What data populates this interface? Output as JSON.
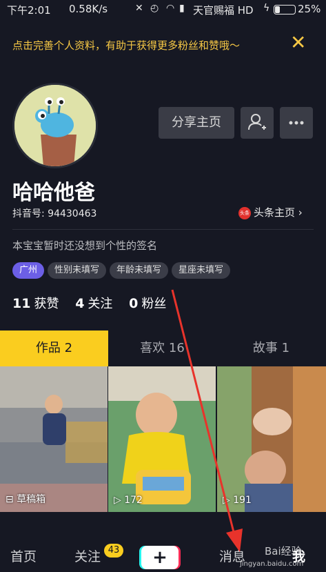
{
  "status_bar": {
    "time": "下午2:01",
    "speed": "0.58K/s",
    "carrier": "天官赐福 HD",
    "battery": "25%"
  },
  "notice": {
    "text": "点击完善个人资料，有助于获得更多粉丝和赞哦～",
    "close_icon": "close-icon"
  },
  "profile": {
    "share_label": "分享主页",
    "add_friend_icon": "add-user-icon",
    "more_icon": "more-icon",
    "name": "哈哈他爸",
    "douyin_id": "抖音号: 94430463",
    "toutiao_logo": "头条",
    "toutiao_label": "头条主页",
    "bio": "本宝宝暂时还没想到个性的签名",
    "tags": [
      "广州",
      "性别未填写",
      "年龄未填写",
      "星座未填写"
    ],
    "stats": {
      "likes_num": "11",
      "likes_label": "获赞",
      "following_num": "4",
      "following_label": "关注",
      "fans_num": "0",
      "fans_label": "粉丝"
    }
  },
  "tabs": [
    {
      "label": "作品 2",
      "active": true
    },
    {
      "label": "喜欢 16",
      "active": false
    },
    {
      "label": "故事 1",
      "active": false
    }
  ],
  "grid": [
    {
      "caption": "草稿箱",
      "icon": "drafts-icon"
    },
    {
      "caption": "172",
      "icon": "play-icon"
    },
    {
      "caption": "191",
      "icon": "play-icon"
    }
  ],
  "bottom_nav": {
    "home": "首页",
    "follow": "关注",
    "follow_badge": "43",
    "plus": "+",
    "messages": "消息",
    "me": "我"
  },
  "watermark": {
    "logo": "Bai经验",
    "url": "jingyan.baidu.com"
  },
  "colors": {
    "background": "#161823",
    "accent_yellow": "#facd1f",
    "location_tag": "#6c5fe6",
    "arrow_red": "#e8332b"
  }
}
